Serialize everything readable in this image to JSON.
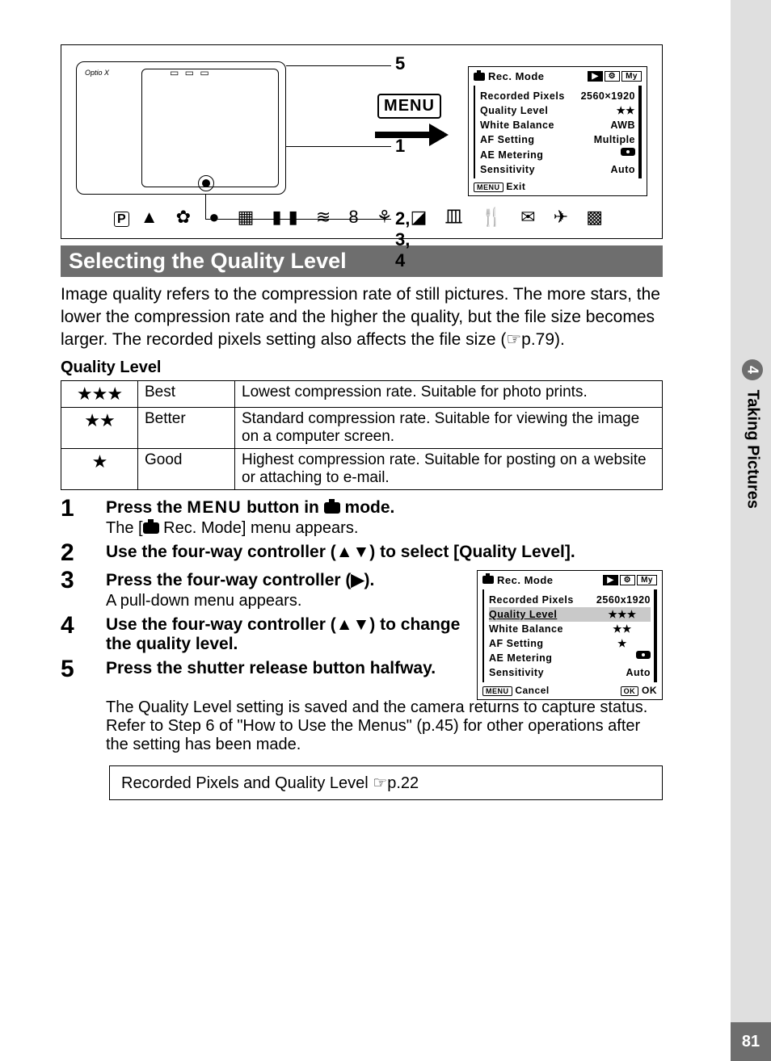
{
  "page_number": "81",
  "side_tab": {
    "chapter_num": "4",
    "chapter_title": "Taking Pictures"
  },
  "illustration": {
    "camera_label": "Optio X",
    "callouts": {
      "top": "5",
      "mid": "1",
      "bottom": "2, 3, 4"
    },
    "menu_button": "MENU"
  },
  "screen1": {
    "title": "Rec. Mode",
    "tabs": [
      "▶",
      "⚙",
      "My"
    ],
    "rows": [
      {
        "label": "Recorded Pixels",
        "value": "2560×1920"
      },
      {
        "label": "Quality Level",
        "value": "★★"
      },
      {
        "label": "White Balance",
        "value": "AWB"
      },
      {
        "label": "AF Setting",
        "value": "Multiple"
      },
      {
        "label": "AE Metering",
        "value": "⦿"
      },
      {
        "label": "Sensitivity",
        "value": "Auto"
      }
    ],
    "footer": "Exit"
  },
  "icons_row": "ⓟ ▲ ✿ ● ▣ ▮▮ ≋ 8 ⚘ ◪ 血 🍴 ✉ ✈ ▦",
  "section_heading": "Selecting the Quality Level",
  "intro": "Image quality refers to the compression rate of still pictures.\nThe more stars, the lower the compression rate and the higher the quality, but the file size becomes larger. The recorded pixels setting also affects the file size (☞p.79).",
  "table_title": "Quality Level",
  "quality_table": [
    {
      "stars": "★★★",
      "name": "Best",
      "desc": "Lowest compression rate. Suitable for photo prints."
    },
    {
      "stars": "★★",
      "name": "Better",
      "desc": "Standard compression rate. Suitable for viewing the image on a computer screen."
    },
    {
      "stars": "★",
      "name": "Good",
      "desc": "Highest compression rate. Suitable for posting on a website or attaching to e-mail."
    }
  ],
  "steps": [
    {
      "n": "1",
      "head_pre": "Press the ",
      "head_menu": "MENU",
      "head_post": " button in ",
      "head_end": " mode.",
      "sub": "The [   Rec. Mode] menu appears.",
      "sub_pre": "The [",
      "sub_post": " Rec. Mode] menu appears."
    },
    {
      "n": "2",
      "head": "Use the four-way controller (▲▼) to select [Quality Level]."
    },
    {
      "n": "3",
      "head": "Press the four-way controller (▶).",
      "sub": "A pull-down menu appears."
    },
    {
      "n": "4",
      "head": "Use the four-way controller (▲▼) to change the quality level."
    },
    {
      "n": "5",
      "head": "Press the shutter release button halfway.",
      "sub": "The Quality Level setting is saved and the camera returns to capture status.\nRefer to Step 6 of \"How to Use the Menus\" (p.45) for other operations after the setting has been made."
    }
  ],
  "screen2": {
    "title": "Rec. Mode",
    "tabs": [
      "▶",
      "⚙",
      "My"
    ],
    "rows": [
      {
        "label": "Recorded Pixels",
        "value": "2560x1920"
      },
      {
        "label": "Quality Level",
        "value": "★★★",
        "selected": true
      },
      {
        "label": "White Balance",
        "value": "★★"
      },
      {
        "label": "AF Setting",
        "value": "★"
      },
      {
        "label": "AE Metering",
        "value": "⦿"
      },
      {
        "label": "Sensitivity",
        "value": "Auto"
      }
    ],
    "footer_left": "Cancel",
    "footer_right": "OK"
  },
  "ref_box": "Recorded Pixels and Quality Level ☞p.22"
}
